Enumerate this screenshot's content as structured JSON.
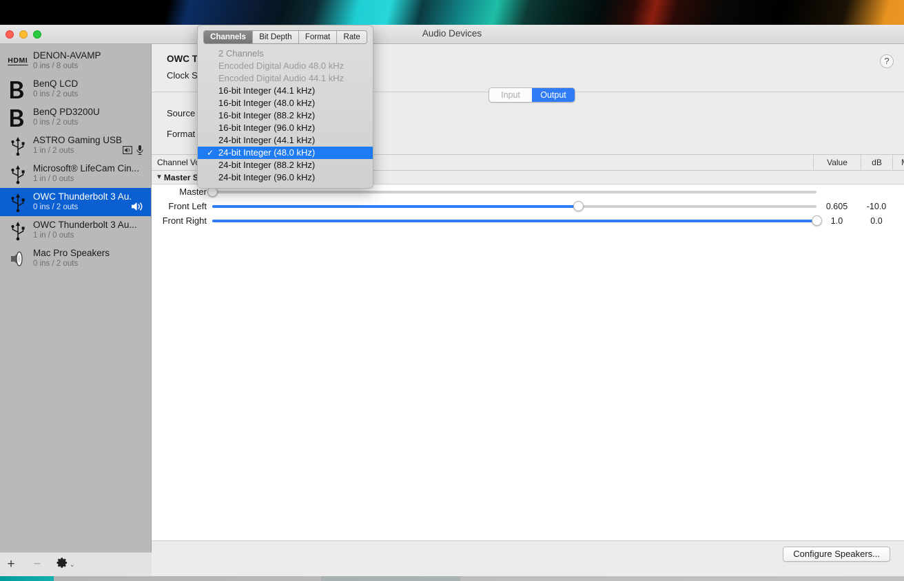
{
  "window": {
    "title": "Audio Devices",
    "help_label": "?"
  },
  "sidebar": {
    "devices": [
      {
        "name": "DENON-AVAMP",
        "io": "0 ins / 8 outs",
        "icon": "hdmi-icon",
        "selected": false,
        "badges": []
      },
      {
        "name": "BenQ LCD",
        "io": "0 ins / 2 outs",
        "icon": "displayport-icon",
        "selected": false,
        "badges": []
      },
      {
        "name": "BenQ PD3200U",
        "io": "0 ins / 2 outs",
        "icon": "displayport-icon",
        "selected": false,
        "badges": []
      },
      {
        "name": "ASTRO Gaming USB Mi...",
        "io": "1 in / 2 outs",
        "icon": "usb-icon",
        "selected": false,
        "badges": [
          "sound-input-default-icon",
          "microphone-icon"
        ]
      },
      {
        "name": "Microsoft® LifeCam Cin...",
        "io": "1 in / 0 outs",
        "icon": "usb-icon",
        "selected": false,
        "badges": []
      },
      {
        "name": "OWC Thunderbolt 3 Au...",
        "io": "0 ins / 2 outs",
        "icon": "usb-icon",
        "selected": true,
        "badges": [
          "speaker-output-icon"
        ]
      },
      {
        "name": "OWC Thunderbolt 3 Au...",
        "io": "1 in / 0 outs",
        "icon": "usb-icon",
        "selected": false,
        "badges": []
      },
      {
        "name": "Mac Pro Speakers",
        "io": "0 ins / 2 outs",
        "icon": "speaker-icon",
        "selected": false,
        "badges": []
      }
    ],
    "footer": {
      "add_label": "+",
      "remove_label": "−",
      "gear_label": "gear-icon",
      "chevron_label": "⌄"
    }
  },
  "main": {
    "device_title": "OWC T",
    "clock_source_label": "Clock S",
    "source_label": "Source",
    "format_label": "Format",
    "io_toggle": {
      "input": "Input",
      "output": "Output",
      "selected": "Output"
    },
    "channel_volume_label": "Channel Vo",
    "columns": {
      "value": "Value",
      "db": "dB",
      "mute": "Mute"
    },
    "stream": {
      "label": "Master Stream",
      "expanded": true,
      "rows": [
        {
          "label": "Master",
          "value": "",
          "db": "",
          "fraction": 0.0,
          "muted": false,
          "enabled": false
        },
        {
          "label": "Front Left",
          "value": "0.605",
          "db": "-10.0",
          "fraction": 0.605,
          "muted": false,
          "enabled": true
        },
        {
          "label": "Front Right",
          "value": "1.0",
          "db": "0.0",
          "fraction": 1.0,
          "muted": false,
          "enabled": true
        }
      ]
    },
    "configure_speakers_label": "Configure Speakers..."
  },
  "popup": {
    "segments": [
      {
        "label": "Channels",
        "active": true
      },
      {
        "label": "Bit Depth",
        "active": false
      },
      {
        "label": "Format",
        "active": false
      },
      {
        "label": "Rate",
        "active": false
      }
    ],
    "items": [
      {
        "label": "2 Channels",
        "state": "header"
      },
      {
        "label": "Encoded Digital Audio 48.0 kHz",
        "state": "dim"
      },
      {
        "label": "Encoded Digital Audio 44.1 kHz",
        "state": "dim"
      },
      {
        "label": "16-bit Integer (44.1 kHz)",
        "state": "normal"
      },
      {
        "label": "16-bit Integer (48.0 kHz)",
        "state": "normal"
      },
      {
        "label": "16-bit Integer (88.2 kHz)",
        "state": "normal"
      },
      {
        "label": "16-bit Integer (96.0 kHz)",
        "state": "normal"
      },
      {
        "label": "24-bit Integer (44.1 kHz)",
        "state": "normal"
      },
      {
        "label": "24-bit Integer (48.0 kHz)",
        "state": "selected"
      },
      {
        "label": "24-bit Integer (88.2 kHz)",
        "state": "normal"
      },
      {
        "label": "24-bit Integer (96.0 kHz)",
        "state": "normal"
      }
    ],
    "check_glyph": "✓"
  },
  "colors": {
    "accent_blue": "#2f7cf6",
    "selection_blue": "#0b5fd0",
    "menu_selection_blue": "#1e7bf2"
  }
}
